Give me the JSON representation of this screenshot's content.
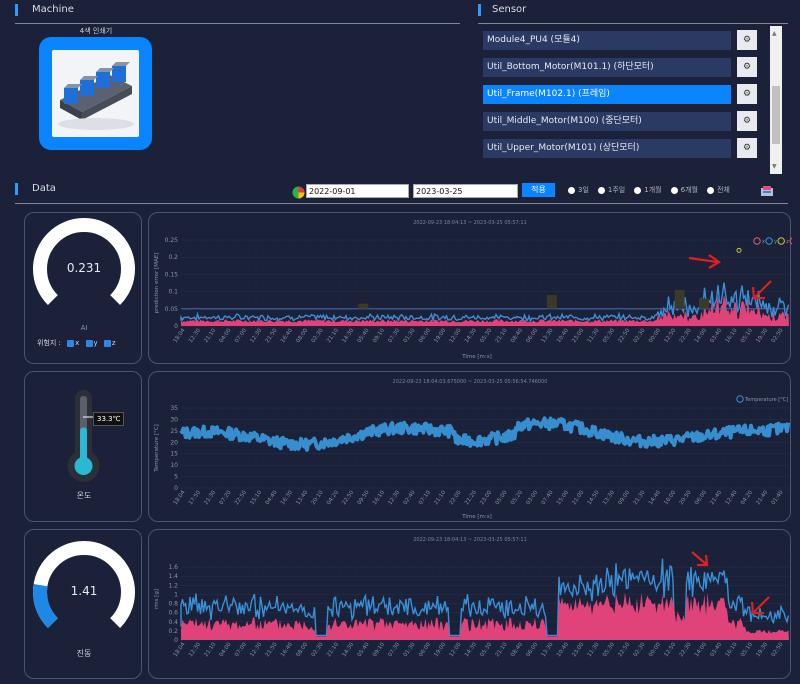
{
  "machine": {
    "title": "Machine",
    "name": "4색 인쇄기"
  },
  "sensor": {
    "title": "Sensor",
    "items": [
      {
        "label": "Module4_PU4 (모듈4)",
        "selected": false
      },
      {
        "label": "Util_Bottom_Motor(M101.1) (하단모터)",
        "selected": false
      },
      {
        "label": "Util_Frame(M102.1) (프레임)",
        "selected": true
      },
      {
        "label": "Util_Middle_Motor(M100) (중단모터)",
        "selected": false
      },
      {
        "label": "Util_Upper_Motor(M101) (상단모터)",
        "selected": false
      }
    ]
  },
  "data_section": {
    "title": "Data",
    "start_date": "2022-09-01",
    "end_date": "2023-03-25",
    "apply_label": "적용",
    "ranges": [
      "3일",
      "1주일",
      "1개월",
      "6개월",
      "전체"
    ]
  },
  "gauges": {
    "ai": {
      "value": "0.231",
      "fraction": 0.231,
      "label": "AI",
      "axis_label": "위험지 :",
      "axes": [
        "x",
        "y",
        "z"
      ]
    },
    "temp": {
      "value": "33.3℃",
      "fraction": 0.55,
      "label": "온도"
    },
    "vib": {
      "value": "1.41",
      "fraction": 0.2,
      "label": "진동"
    }
  },
  "chart_data": [
    {
      "type": "line",
      "title": "2022-09-23 18:04:13 ~ 2023-03-25 05:57:11",
      "ylabel": "prediction error [MAE]",
      "xlabel": "Time [m:s]",
      "ylim": [
        0,
        0.25
      ],
      "yticks": [
        "0.25",
        "0.2",
        "0.15",
        "0.1",
        "0.05",
        "0"
      ],
      "legend": [
        "x",
        "y",
        "z",
        "x-threshold",
        "y-threshold",
        "z-threshold"
      ],
      "xticks": [
        "18:04",
        "12:30",
        "21:10",
        "04:00",
        "07:00",
        "12:30",
        "21:50",
        "16:40",
        "08:00",
        "02:30",
        "21:10",
        "14:30",
        "05:40",
        "09:10",
        "07:30",
        "01:30",
        "06:00",
        "19:00",
        "12:00",
        "14:30",
        "05:30",
        "21:10",
        "08:40",
        "06:00",
        "13:30",
        "10:40",
        "23:00",
        "11:30",
        "05:30",
        "22:50",
        "02:30",
        "00:00",
        "12:50",
        "22:30",
        "14:00",
        "03:40",
        "16:10",
        "05:10",
        "19:30",
        "02:50"
      ]
    },
    {
      "type": "line",
      "title": "2022-09-23 18:04:03.675000 ~ 2023-03-25 05:56:54.746000",
      "ylabel": "Temperature [°C]",
      "xlabel": "Time [m:s]",
      "ylim": [
        0,
        35
      ],
      "yticks": [
        "35",
        "30",
        "25",
        "20",
        "15",
        "10",
        "5",
        "0"
      ],
      "legend": [
        "Temperature [°C]"
      ],
      "xticks": [
        "18:04",
        "17:50",
        "21:30",
        "07:20",
        "22:50",
        "15:10",
        "04:40",
        "16:30",
        "13:40",
        "20:10",
        "04:20",
        "22:50",
        "09:50",
        "16:10",
        "12:30",
        "02:40",
        "07:10",
        "21:10",
        "22:00",
        "21:20",
        "23:00",
        "05:00",
        "05:20",
        "03:00",
        "07:40",
        "15:00",
        "21:00",
        "14:50",
        "13:30",
        "09:00",
        "21:30",
        "14:40",
        "16:00",
        "20:50",
        "06:00",
        "21:40",
        "12:40",
        "04:20",
        "21:40",
        "01:40"
      ]
    },
    {
      "type": "line",
      "title": "2022-09-23 18:04:13 ~ 2023-03-25 05:57:11",
      "ylabel": "rms [g]",
      "xlabel": "",
      "ylim": [
        0,
        1.8
      ],
      "yticks": [
        "1.6",
        "1.4",
        "1.2",
        "1",
        "0.8",
        "0.6",
        "0.4",
        "0.2",
        "0"
      ],
      "legend": [
        "x",
        "y",
        "z"
      ],
      "xticks": [
        "18:04",
        "12:30",
        "21:10",
        "04:00",
        "07:00",
        "12:30",
        "21:50",
        "16:40",
        "08:00",
        "02:30",
        "21:10",
        "14:30",
        "05:40",
        "09:10",
        "07:30",
        "01:30",
        "06:00",
        "19:00",
        "12:00",
        "14:30",
        "05:30",
        "21:10",
        "08:40",
        "06:00",
        "13:30",
        "10:40",
        "23:00",
        "11:30",
        "05:30",
        "22:50",
        "02:30",
        "00:00",
        "12:50",
        "22:30",
        "14:00",
        "03:40",
        "16:10",
        "05:10",
        "19:30",
        "02:50"
      ]
    }
  ]
}
